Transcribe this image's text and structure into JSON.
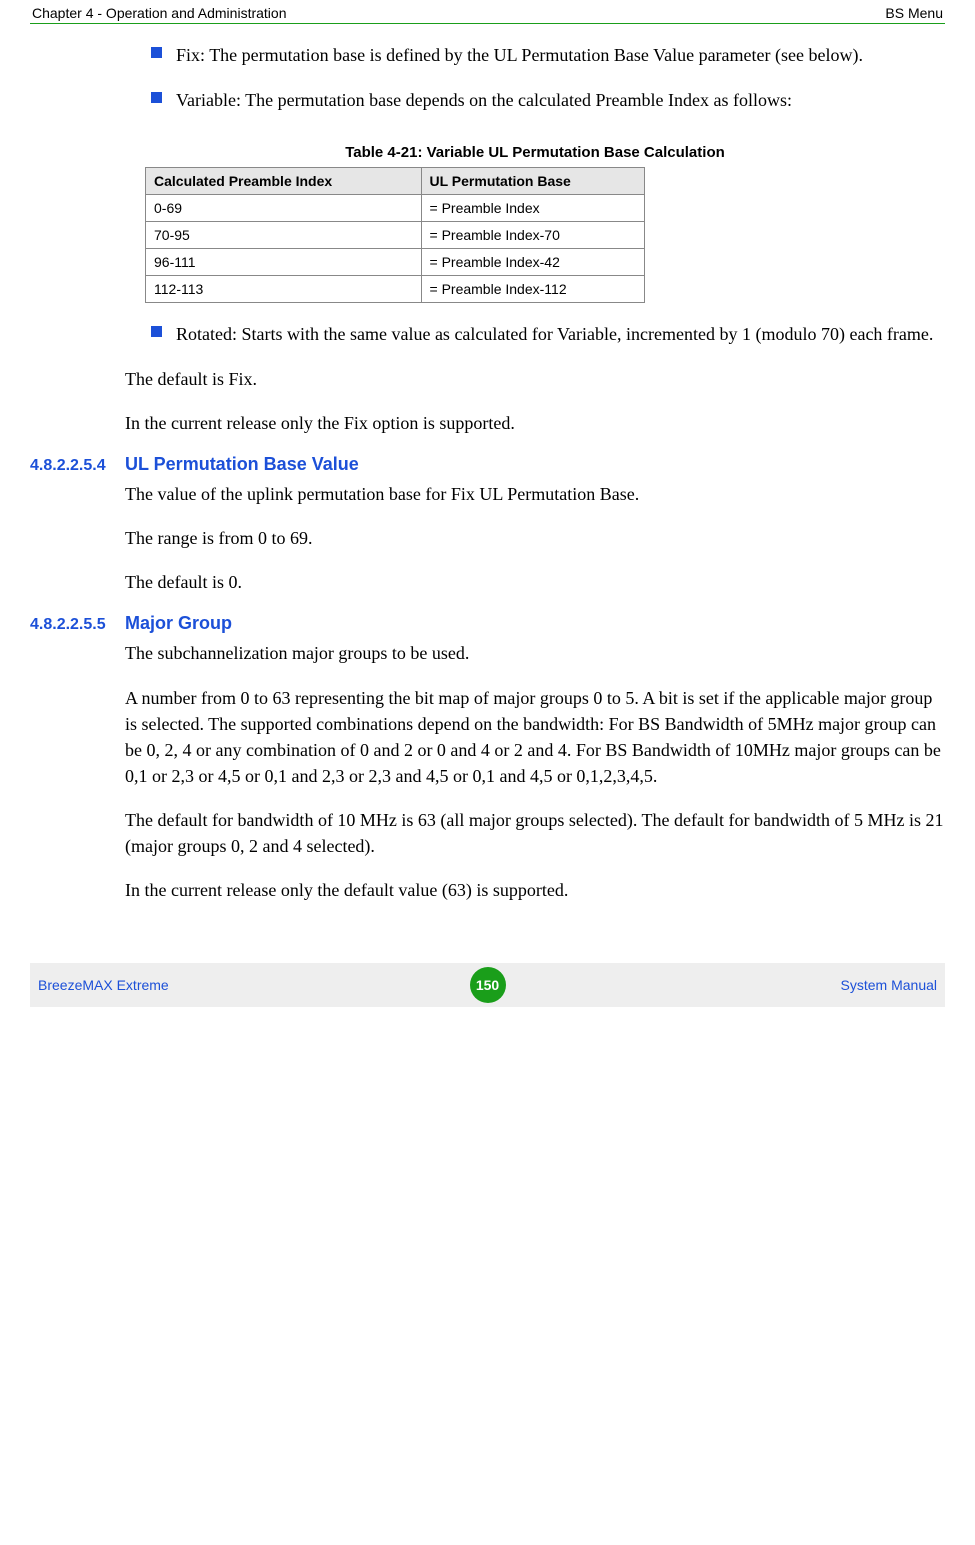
{
  "header": {
    "left": "Chapter 4 - Operation and Administration",
    "right": "BS Menu"
  },
  "bullets": {
    "fix": "Fix: The permutation base is defined by the UL Permutation Base Value parameter (see below).",
    "variable": "Variable: The permutation base depends on the calculated Preamble Index as follows:",
    "rotated": "Rotated: Starts with the same value as calculated for Variable, incremented by 1 (modulo 70) each frame."
  },
  "table": {
    "caption": "Table 4-21: Variable UL Permutation Base Calculation",
    "headers": {
      "col1": "Calculated Preamble Index",
      "col2": "UL Permutation Base"
    },
    "rows": [
      {
        "c1": "0-69",
        "c2": "= Preamble Index"
      },
      {
        "c1": "70-95",
        "c2": "= Preamble Index-70"
      },
      {
        "c1": "96-111",
        "c2": "= Preamble Index-42"
      },
      {
        "c1": "112-113",
        "c2": "= Preamble Index-112"
      }
    ]
  },
  "paras": {
    "default_fix": "The default is Fix.",
    "fix_only": "In the current release only the Fix option is supported.",
    "p4": {
      "num": "4.8.2.2.5.4",
      "title": "UL Permutation Base Value",
      "l1": "The value of the uplink permutation base for Fix UL Permutation Base.",
      "l2": "The range is from 0 to 69.",
      "l3": "The default is 0."
    },
    "p5": {
      "num": "4.8.2.2.5.5",
      "title": "Major Group",
      "l1": "The subchannelization major groups to be used.",
      "l2": "A number from 0 to 63 representing the bit map of major groups 0 to 5. A bit is set if the applicable major group is selected. The supported combinations depend on the bandwidth: For BS Bandwidth of 5MHz major group can be 0, 2, 4 or any combination of 0 and 2 or 0 and 4 or 2 and 4. For BS Bandwidth of 10MHz major groups can be 0,1 or 2,3 or 4,5 or 0,1 and 2,3 or 2,3 and 4,5 or 0,1 and 4,5 or 0,1,2,3,4,5.",
      "l3": "The default for bandwidth of 10 MHz is 63 (all major groups selected). The default for bandwidth of 5 MHz is 21 (major groups 0, 2 and 4 selected).",
      "l4": "In the current release only the default value (63) is supported."
    }
  },
  "footer": {
    "left": "BreezeMAX Extreme",
    "page": "150",
    "right": "System Manual"
  }
}
